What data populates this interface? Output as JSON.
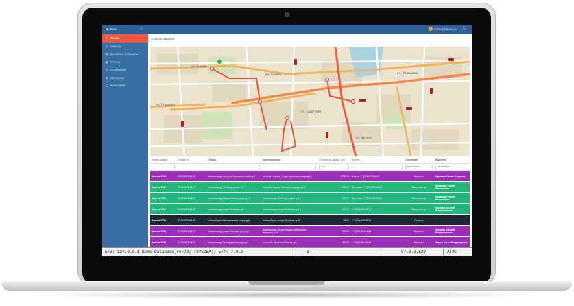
{
  "window": {
    "brand": "⊞ Фикс"
  },
  "topbar": {
    "menu_icon": "≡",
    "user_name": "admin@demo.ru",
    "signout_icon": "⏻"
  },
  "sidebar": {
    "items": [
      {
        "icon": "♥",
        "label": "Заказы",
        "active": true
      },
      {
        "icon": "♙",
        "label": "Клиенты",
        "active": false
      },
      {
        "icon": "▤",
        "label": "Денежные операции",
        "active": false
      },
      {
        "icon": "▣",
        "label": "Отчеты",
        "active": false
      },
      {
        "icon": "◎",
        "label": "Посредники",
        "active": false
      },
      {
        "icon": "⚙",
        "label": "Настройки",
        "active": false
      },
      {
        "icon": "▢",
        "label": "Мониторинг",
        "active": false
      }
    ]
  },
  "content": {
    "breadcrumb": "Список заказов"
  },
  "map": {
    "labels": {
      "l1": "ул. Кирова",
      "l2": "ул. Тельмана",
      "l3": "ул. Ленина",
      "l4": "ул. Малышева",
      "l5": "ул. Советская",
      "l6": "ул. Фрунзе"
    }
  },
  "table": {
    "headers": [
      "Номер заказа",
      "Создан ⇅",
      "Откуда",
      "Конечная точка",
      "Стоимость заказа, руб",
      "Клиент",
      "Состояние",
      "Водитель"
    ],
    "filters": {
      "cost": "0.00",
      "state": "Не выбрано",
      "driver": "Не выбрано"
    },
    "rows": [
      {
        "style": "purple",
        "num": "Заказ №7343",
        "date": "28.02.2018 14:54",
        "from": "Калининград, переулок Университетский, д.2",
        "to": "посёлок Невское, Индустриальная улица, д.8",
        "cost": "2750.00",
        "client": "Ижевск +7 (912) 073-15-21",
        "state": "Выполнен",
        "driver": "Караваев Олжас Игоревич"
      },
      {
        "style": "green",
        "num": "Заказ №7342",
        "date": "28.02.2018 13:47",
        "from": "Калининград, Литейная улица, д.7",
        "to": "посёлок Невское, Советская улица, д.15",
        "cost": "250.00",
        "client": "Ярославл +7 (912) 114-00-80",
        "state": "Выполняется",
        "driver": "Медведев Сергей Николаевич"
      },
      {
        "style": "green",
        "num": "Заказ №7341",
        "date": "28.02.2018 13:34",
        "from": "Калининград, Маршальская улица, д.14",
        "to": "Калининград, Литейная улица, д.8",
        "cost": "350.00",
        "client": "Ярославл +7 (912) 114-00-80",
        "state": "Выполняется",
        "driver": "Медведев Сергей Николаевич"
      },
      {
        "style": "green",
        "num": "Заказ №7340",
        "date": "28.02.2018 13:28",
        "from": "Калининград, улица Литейная, д.1",
        "to": "Калининград, улица Литейная, д.8",
        "cost": "400.00",
        "client": "+7 (912) 203-45-71",
        "state": "Выполняется",
        "driver": "Косилов Алексей Владимирович"
      },
      {
        "style": "dark",
        "num": "Заказ №7339",
        "date": "27.02.2018 22:48",
        "from": "Новосибирск, Маломяньшая улица, д.8",
        "to": "Новосибирск, улица Литейная, д.68",
        "cost": "80.00",
        "client": "+7 (904) 412-22-17",
        "state": "Отменен",
        "driver": ""
      },
      {
        "style": "purple",
        "num": "Заказ №7338",
        "date": "27.02.2018 18:17",
        "from": "Калининград, улица Литейная (ул.), д.1",
        "to": "Калининград, улица Генерал-Лейтенанта Захарова, д.26",
        "cost": "300.00",
        "client": "+7 (905) 240-11-33",
        "state": "Выполнен",
        "driver": "Косилов Алексей Владимирович"
      },
      {
        "style": "purple",
        "num": "Заказ №7338",
        "date": "27.02.2018 13:29",
        "from": "Калининград, Пригородная улица, д.3",
        "to": "Ангелиба, Арсеньев Ленина, д.2",
        "cost": "800.00",
        "client": "+7 (912) 381-06-12",
        "state": "Выполнен",
        "driver": "Ищеев Антон Владимирович"
      }
    ]
  },
  "statusbar": {
    "connection": "Б/а: 127.0.0.1-Demo-Database_ver70; (SYSDBA); Б/г: 7.0.0",
    "count": "3",
    "version": "V7.0.0.529",
    "mode": "АГИС"
  }
}
